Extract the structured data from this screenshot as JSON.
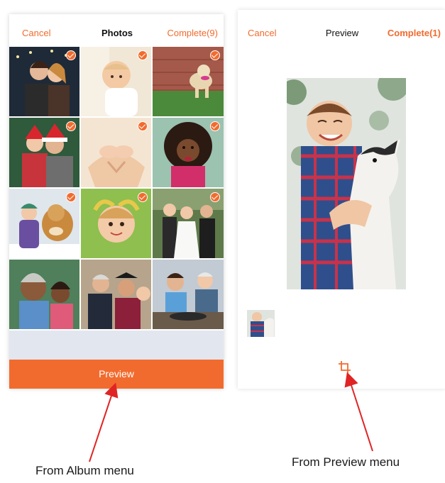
{
  "album": {
    "cancel": "Cancel",
    "title": "Photos",
    "complete": "Complete(9)",
    "preview_button": "Preview"
  },
  "preview": {
    "cancel": "Cancel",
    "title": "Preview",
    "complete": "Complete(1)"
  },
  "captions": {
    "album": "From Album menu",
    "preview": "From Preview menu"
  },
  "colors": {
    "accent": "#f26b2e",
    "arrow": "#e02424",
    "strip": "#e2e6ef"
  },
  "icons": [
    "checkmark-icon",
    "crop-icon"
  ]
}
